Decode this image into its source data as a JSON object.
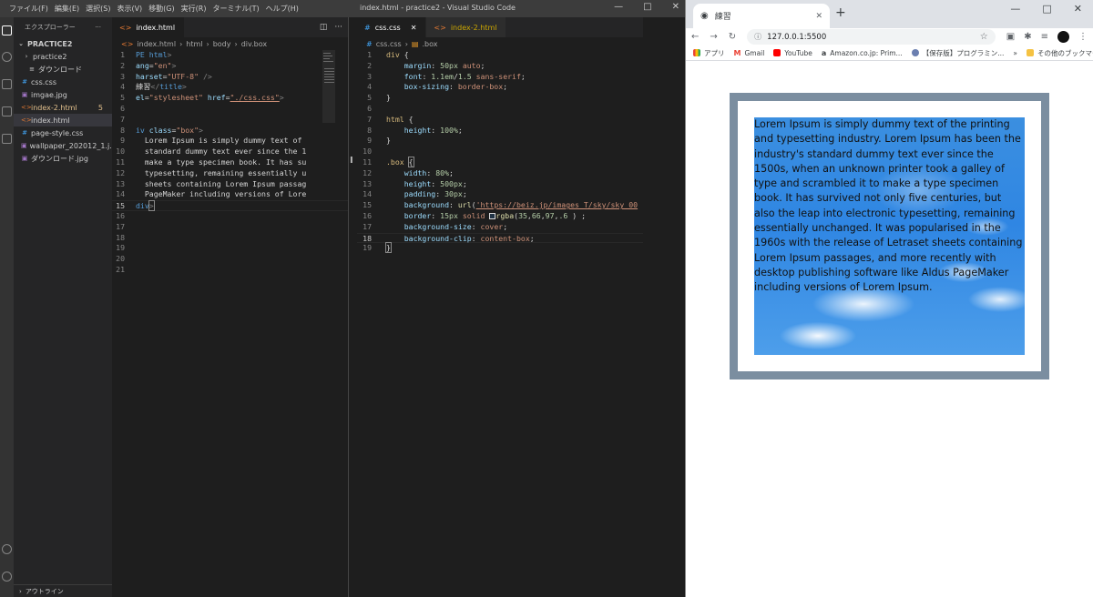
{
  "vscode": {
    "menu": [
      "ファイル(F)",
      "編集(E)",
      "選択(S)",
      "表示(V)",
      "移動(G)",
      "実行(R)",
      "ターミナル(T)",
      "ヘルプ(H)"
    ],
    "window_title": "index.html - practice2 - Visual Studio Code",
    "explorer_title": "エクスプローラー",
    "tree": [
      {
        "label": "PRACTICE2",
        "icon": "chevron",
        "indent": 0,
        "bold": true
      },
      {
        "label": "practice2",
        "icon": "folder-chevron",
        "indent": 1
      },
      {
        "label": "ダウンロード",
        "icon": "file-icon",
        "indent": 2
      },
      {
        "label": "css.css",
        "icon": "css",
        "indent": 1
      },
      {
        "label": "imgae.jpg",
        "icon": "image",
        "indent": 1
      },
      {
        "label": "index-2.html",
        "icon": "html",
        "indent": 1,
        "badge": "5",
        "modified": true
      },
      {
        "label": "index.html",
        "icon": "html",
        "indent": 1,
        "selected": true
      },
      {
        "label": "page-style.css",
        "icon": "css",
        "indent": 1
      },
      {
        "label": "wallpaper_202012_1.j...",
        "icon": "image",
        "indent": 1
      },
      {
        "label": "ダウンロード.jpg",
        "icon": "image",
        "indent": 1
      }
    ],
    "outline_label": "アウトライン",
    "editor1": {
      "tab": "index.html",
      "breadcrumb": [
        "index.html",
        "html",
        "body",
        "div.box"
      ],
      "current_line": 15
    },
    "editor2": {
      "tabs": [
        "css.css",
        "index-2.html"
      ],
      "breadcrumb": [
        "css.css",
        ".box"
      ],
      "current_line": 18
    }
  },
  "chrome": {
    "tab_title": "練習",
    "url": "127.0.0.1:5500",
    "bookmarks": [
      "アプリ",
      "Gmail",
      "YouTube",
      "Amazon.co.jp: Prim...",
      "【保存版】プログラミン..."
    ],
    "other_bookmarks": "その他のブックマーク",
    "box_text": "Lorem Ipsum is simply dummy text of the printing and typesetting industry. Lorem Ipsum has been the industry's standard dummy text ever since the 1500s, when an unknown printer took a galley of type and scrambled it to make a type specimen book. It has survived not only five centuries, but also the leap into electronic typesetting, remaining essentially unchanged. It was popularised in the 1960s with the release of Letraset sheets containing Lorem Ipsum passages, and more recently with desktop publishing software like Aldus PageMaker including versions of Lorem Ipsum."
  },
  "colors": {
    "box_border": "#8a97a6",
    "sky": "#2f86e3",
    "editor_bg": "#1e1e1e"
  }
}
